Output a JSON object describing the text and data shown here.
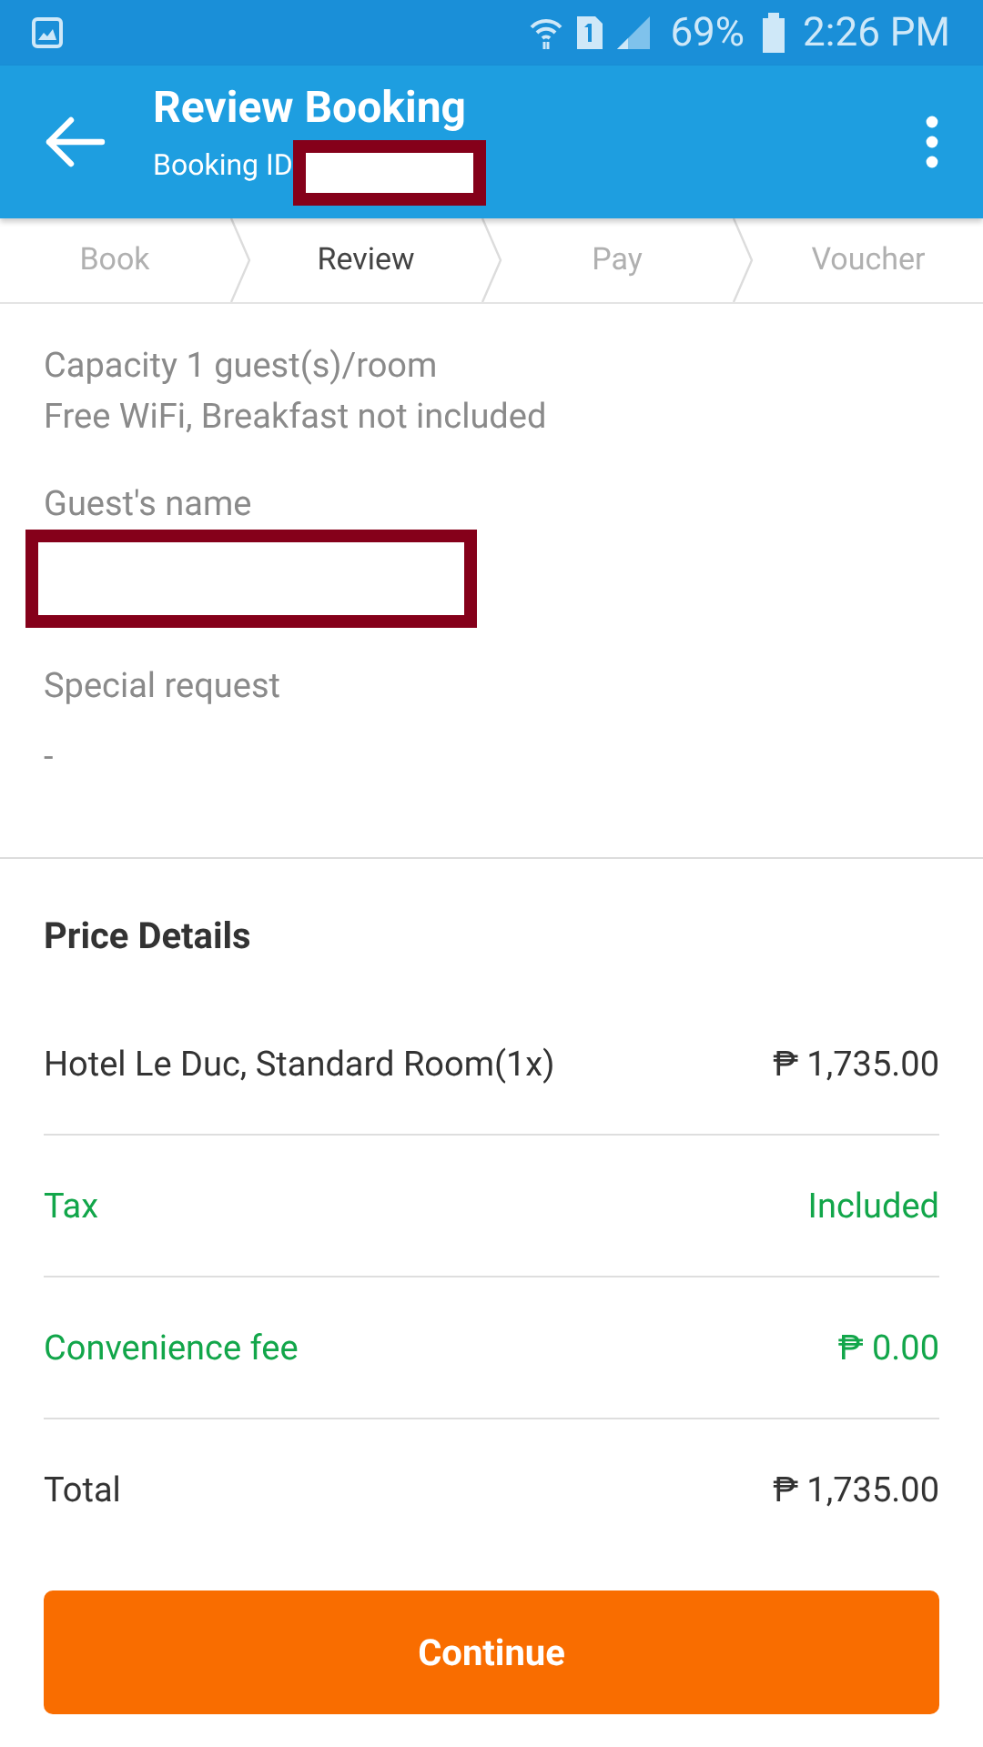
{
  "status_bar": {
    "battery": "69%",
    "time": "2:26 PM"
  },
  "app_bar": {
    "title": "Review Booking",
    "subtitle": "Booking ID"
  },
  "steps": [
    {
      "label": "Book",
      "selected": false
    },
    {
      "label": "Review",
      "selected": true
    },
    {
      "label": "Pay",
      "selected": false
    },
    {
      "label": "Voucher",
      "selected": false
    }
  ],
  "room_info": [
    "Capacity 1 guest(s)/room",
    "Free WiFi, Breakfast not included"
  ],
  "guest": {
    "label": "Guest's name"
  },
  "special_request": {
    "label": "Special request",
    "value": "-"
  },
  "price_details": {
    "title": "Price Details",
    "rows": [
      {
        "label": "Hotel Le Duc, Standard Room(1x)",
        "value": "₱ 1,735.00",
        "kind": "plain"
      },
      {
        "label": "Tax",
        "value": "Included",
        "kind": "highlight"
      },
      {
        "label": "Convenience fee",
        "value": "₱ 0.00",
        "kind": "highlight"
      },
      {
        "label": "Total",
        "value": "₱ 1,735.00",
        "kind": "plain"
      }
    ]
  },
  "button": "Continue"
}
